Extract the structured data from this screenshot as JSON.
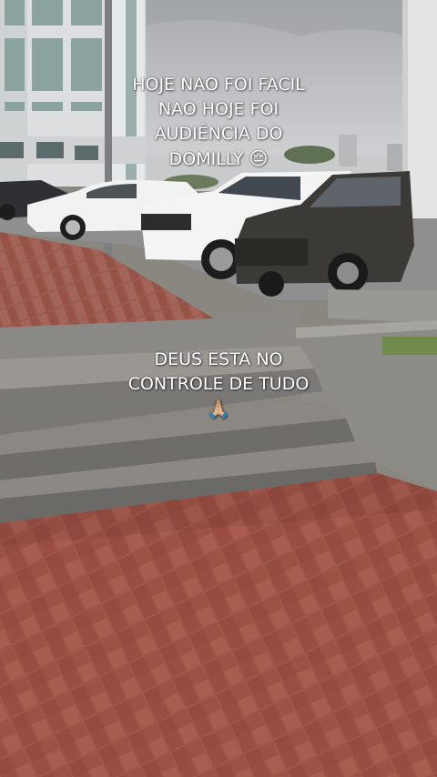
{
  "overlay_text": {
    "top": {
      "lines": [
        "HOJE NAO FOI FACIL",
        "NAO HOJE FOI",
        "AUDIÊNCIA DO",
        "DOMILLY"
      ],
      "emoji": "😔"
    },
    "bottom": {
      "lines": [
        "DEUS ESTA NO",
        "CONTROLE DE TUDO"
      ],
      "emoji": "🙏🏼"
    }
  },
  "colors": {
    "sky": "#b9bcbf",
    "building": "#dfe1e2",
    "pavement_brick": "#9c4f45",
    "steps": "#7d7b77",
    "white_car": "#f2f2f2",
    "dark_car": "#3c3a36"
  }
}
